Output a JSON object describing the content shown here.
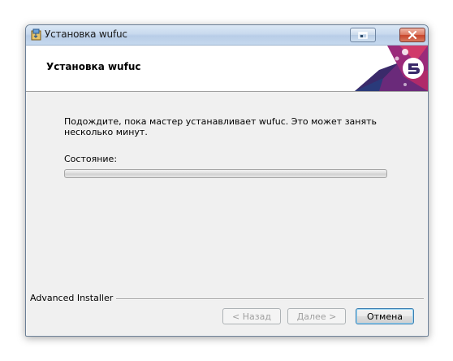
{
  "window": {
    "title": "Установка wufuc",
    "header_title": "Установка wufuc"
  },
  "content": {
    "message": "Подождите, пока мастер устанавливает wufuc. Это может занять несколько минут.",
    "status_label": "Состояние:",
    "progress": 0
  },
  "footer": {
    "brand": "Advanced Installer"
  },
  "buttons": {
    "back": "< Назад",
    "next": "Далее >",
    "cancel": "Отмена"
  },
  "icons": {
    "app": "installer-icon",
    "restore": "restore-icon",
    "close": "close-icon"
  },
  "colors": {
    "accent_purple": "#5a2a7a",
    "accent_pink": "#c0307a",
    "accent_blue": "#3c7fb1"
  }
}
